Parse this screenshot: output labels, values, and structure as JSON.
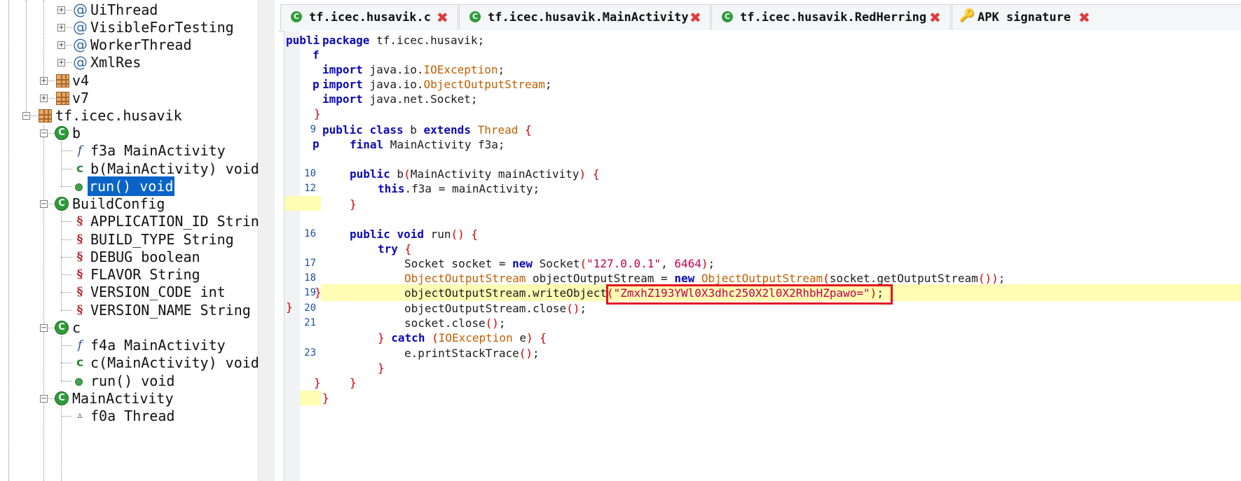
{
  "tree": {
    "items": [
      {
        "label": "UiThread",
        "icon": "annotation-icon"
      },
      {
        "label": "VisibleForTesting",
        "icon": "annotation-icon"
      },
      {
        "label": "WorkerThread",
        "icon": "annotation-icon"
      },
      {
        "label": "XmlRes",
        "icon": "annotation-icon"
      },
      {
        "label": "v4",
        "icon": "package-icon"
      },
      {
        "label": "v7",
        "icon": "package-icon"
      },
      {
        "label": "tf.icec.husavik",
        "icon": "package-icon"
      },
      {
        "label": "b",
        "icon": "class-icon"
      },
      {
        "label": "f3a MainActivity",
        "icon": "field-icon"
      },
      {
        "label": "b(MainActivity) void",
        "icon": "constructor-icon"
      },
      {
        "label": "run() void",
        "icon": "method-icon"
      },
      {
        "label": "BuildConfig",
        "icon": "class-icon"
      },
      {
        "label": "APPLICATION_ID String",
        "icon": "static-final-field-icon"
      },
      {
        "label": "BUILD_TYPE String",
        "icon": "static-final-field-icon"
      },
      {
        "label": "DEBUG boolean",
        "icon": "static-final-field-icon"
      },
      {
        "label": "FLAVOR String",
        "icon": "static-final-field-icon"
      },
      {
        "label": "VERSION_CODE int",
        "icon": "static-final-field-icon"
      },
      {
        "label": "VERSION_NAME String",
        "icon": "static-final-field-icon"
      },
      {
        "label": "c",
        "icon": "class-icon"
      },
      {
        "label": "f4a MainActivity",
        "icon": "field-icon"
      },
      {
        "label": "c(MainActivity) void",
        "icon": "constructor-icon"
      },
      {
        "label": "run() void",
        "icon": "method-icon"
      },
      {
        "label": "MainActivity",
        "icon": "class-icon"
      },
      {
        "label": "f0a Thread",
        "icon": "protected-field-icon"
      }
    ]
  },
  "tabs": [
    {
      "label": "tf.icec.husavik.c",
      "icon": "class-icon"
    },
    {
      "label": "tf.icec.husavik.MainActivity",
      "icon": "class-icon"
    },
    {
      "label": "tf.icec.husavik.RedHerring",
      "icon": "class-icon"
    },
    {
      "label": "APK signature",
      "icon": "key-icon"
    }
  ],
  "code": {
    "clipped_header": "publi",
    "clipped_f": "f",
    "clipped_p1": "p",
    "clipped_p2": "p",
    "brace_close": "}",
    "lines": [
      "package tf.icec.husavik;",
      "import java.io.IOException;",
      "import java.io.ObjectOutputStream;",
      "import java.net.Socket;",
      "public class b extends Thread {",
      "final MainActivity f3a;",
      "public b(MainActivity mainActivity) {",
      "this.f3a = mainActivity;",
      "public void run() {",
      "try {",
      "Socket socket = new Socket(\"127.0.0.1\", 6464);",
      "ObjectOutputStream objectOutputStream = new ObjectOutputStream(socket.getOutputStream());",
      "objectOutputStream.writeObject(\"ZmxhZ193YWl0X3dhc250X2l0X2RhbHZpawo=\");",
      "objectOutputStream.close();",
      "socket.close();",
      "} catch (IOException e) {",
      "e.printStackTrace();"
    ],
    "line_numbers": [
      "9",
      "10",
      "12",
      "16",
      "17",
      "18",
      "19",
      "20",
      "21",
      "23"
    ],
    "highlighted_string": "\"ZmxhZ193YWl0X3dhc250X2l0X2RhbHZpawo=\""
  }
}
